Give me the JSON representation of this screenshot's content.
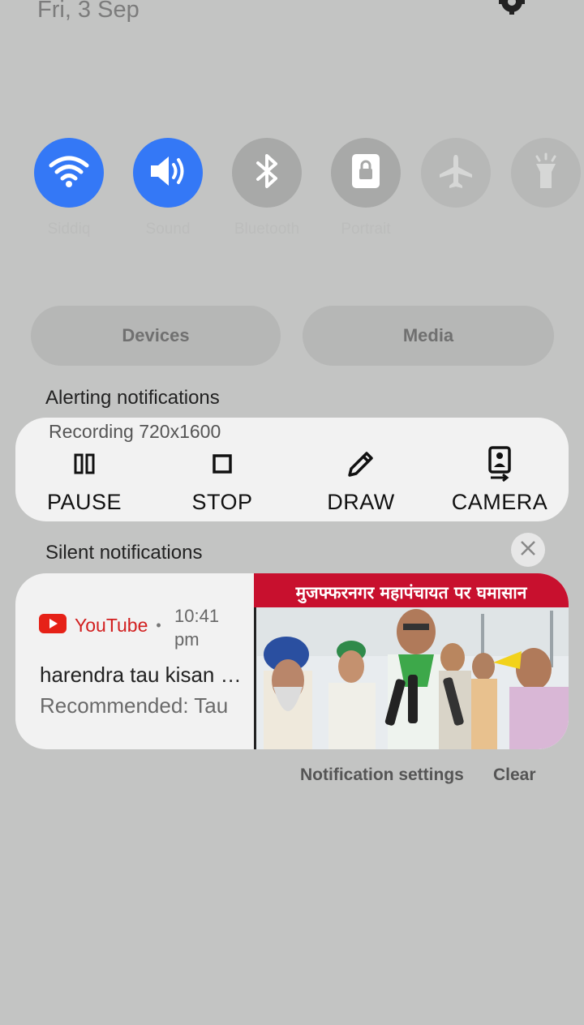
{
  "header": {
    "date": "Fri, 3 Sep"
  },
  "quick_tiles": [
    {
      "label": "Siddiq",
      "icon": "wifi-icon",
      "state": "on"
    },
    {
      "label": "Sound",
      "icon": "sound-icon",
      "state": "on"
    },
    {
      "label": "Bluetooth",
      "icon": "bluetooth-icon",
      "state": "off"
    },
    {
      "label": "Portrait",
      "icon": "portrait-lock-icon",
      "state": "off"
    },
    {
      "label": "",
      "icon": "airplane-icon",
      "state": "off"
    },
    {
      "label": "",
      "icon": "flashlight-icon",
      "state": "off"
    }
  ],
  "buttons": {
    "devices": "Devices",
    "media": "Media"
  },
  "alerting": {
    "section_title": "Alerting notifications",
    "recording_title": "Recording 720x1600",
    "actions": [
      {
        "label": "PAUSE",
        "icon": "pause-icon"
      },
      {
        "label": "STOP",
        "icon": "stop-icon"
      },
      {
        "label": "DRAW",
        "icon": "pencil-icon"
      },
      {
        "label": "CAMERA",
        "icon": "camera-switch-icon"
      }
    ]
  },
  "silent": {
    "section_title": "Silent notifications",
    "notification": {
      "app": "YouTube",
      "time": "10:41 pm",
      "title": "harendra tau kisan mahapanchayat",
      "subtitle": "Recommended: Tau",
      "thumbnail_caption": "मुजफ्फरनगर महापंचायत पर घमासान"
    }
  },
  "footer": {
    "settings": "Notification settings",
    "clear": "Clear"
  },
  "colors": {
    "accent": "#3478f6",
    "youtube_red": "#e62117",
    "card": "#f2f2f2",
    "background": "#c3c4c3"
  }
}
